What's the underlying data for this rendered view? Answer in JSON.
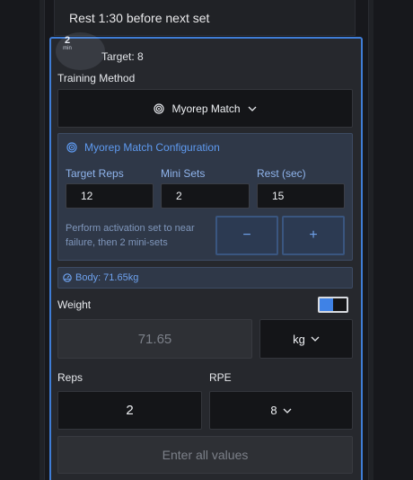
{
  "rest_banner": "Rest 1:30 before next set",
  "timer": {
    "value": "2",
    "unit": "min"
  },
  "target": "Target: 8",
  "training_method": {
    "label": "Training Method",
    "selected": "Myorep Match",
    "icon": "target-icon"
  },
  "config": {
    "title": "Myorep Match Configuration",
    "fields": [
      {
        "label": "Target Reps",
        "value": "12"
      },
      {
        "label": "Mini Sets",
        "value": "2"
      },
      {
        "label": "Rest (sec)",
        "value": "15"
      }
    ],
    "description": "Perform activation set to near failure, then 2 mini-sets",
    "decrement": "−",
    "increment": "+"
  },
  "body_weight": "Body: 71.65kg",
  "weight": {
    "label": "Weight",
    "placeholder": "71.65",
    "unit": "kg",
    "toggle_on": true
  },
  "reps": {
    "label": "Reps",
    "value": "2"
  },
  "rpe": {
    "label": "RPE",
    "value": "8"
  },
  "submit": "Enter all values",
  "colors": {
    "accent": "#3f7dd6",
    "config_text": "#5e9af0",
    "card_bg": "#26282d"
  }
}
